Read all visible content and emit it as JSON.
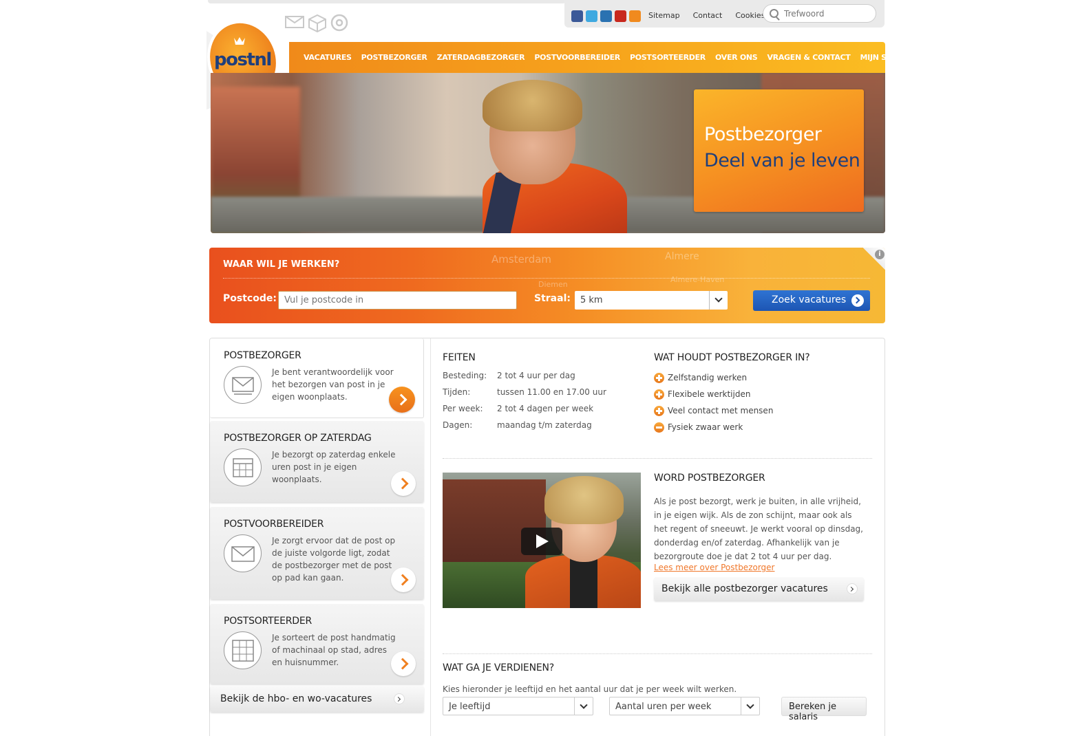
{
  "util": {
    "links": [
      "Sitemap",
      "Contact",
      "Cookies"
    ],
    "search_placeholder": "Trefwoord",
    "social_icons": [
      "facebook-icon",
      "twitter-icon",
      "linkedin-icon",
      "youtube-icon",
      "rss-icon"
    ]
  },
  "logo_text": "postnl",
  "nav": [
    "VACATURES",
    "POSTBEZORGER",
    "ZATERDAGBEZORGER",
    "POSTVOORBEREIDER",
    "POSTSORTEERDER",
    "OVER ONS",
    "VRAGEN & CONTACT",
    "MIJN SOLLICITATIES"
  ],
  "hero": {
    "line1": "Postbezorger",
    "line2": "Deel van je leven"
  },
  "search_band": {
    "title": "WAAR WIL JE WERKEN?",
    "postcode_label": "Postcode:",
    "postcode_placeholder": "Vul je postcode in",
    "straal_label": "Straal:",
    "straal_value": "5 km",
    "button": "Zoek vacatures",
    "map_labels": [
      "Amsterdam",
      "Almere",
      "Almere-Haven",
      "Diemen"
    ]
  },
  "cards": [
    {
      "title": "POSTBEZORGER",
      "text": "Je bent verantwoordelijk voor het bezorgen van post in je eigen woonplaats."
    },
    {
      "title": "POSTBEZORGER OP ZATERDAG",
      "text": "Je bezorgt op zaterdag enkele uren post in je eigen woonplaats."
    },
    {
      "title": "POSTVOORBEREIDER",
      "text": "Je zorgt ervoor dat de post op de juiste volgorde ligt, zodat de postbezorger met de post op pad kan gaan."
    },
    {
      "title": "POSTSORTEERDER",
      "text": "Je sorteert de post handmatig of machinaal op stad, adres en huisnummer."
    }
  ],
  "hbo_link": "Bekijk de hbo- en wo-vacatures",
  "feiten": {
    "title": "FEITEN",
    "rows": [
      {
        "k": "Besteding:",
        "v": "2 tot 4 uur per dag"
      },
      {
        "k": "Tijden:",
        "v": "tussen 11.00 en 17.00 uur"
      },
      {
        "k": "Per week:",
        "v": "2 tot 4 dagen per week"
      },
      {
        "k": "Dagen:",
        "v": "maandag t/m zaterdag"
      }
    ]
  },
  "houdt_in": {
    "title": "WAT HOUDT POSTBEZORGER IN?",
    "items": [
      {
        "text": "Zelfstandig werken",
        "type": "plus"
      },
      {
        "text": "Flexibele werktijden",
        "type": "plus"
      },
      {
        "text": "Veel contact met mensen",
        "type": "plus"
      },
      {
        "text": "Fysiek zwaar werk",
        "type": "min"
      }
    ]
  },
  "word": {
    "title": "WORD POSTBEZORGER",
    "text": "Als je post bezorgt, werk je buiten, in alle vrijheid, in je eigen wijk. Als de zon schijnt, maar ook als het regent of sneeuwt. Je werkt vooral op dinsdag, donderdag en/of zaterdag. Afhankelijk van je bezorgroute doe je dat 2 tot 4 uur per dag.",
    "link": "Lees meer over Postbezorger",
    "button": "Bekijk alle postbezorger vacatures"
  },
  "verdienen": {
    "title": "WAT GA JE VERDIENEN?",
    "text": "Kies hieronder je leeftijd en het aantal uur dat je per week wilt werken.",
    "age_select": "Je leeftijd",
    "hours_select": "Aantal uren per week",
    "button": "Bereken je salaris"
  }
}
